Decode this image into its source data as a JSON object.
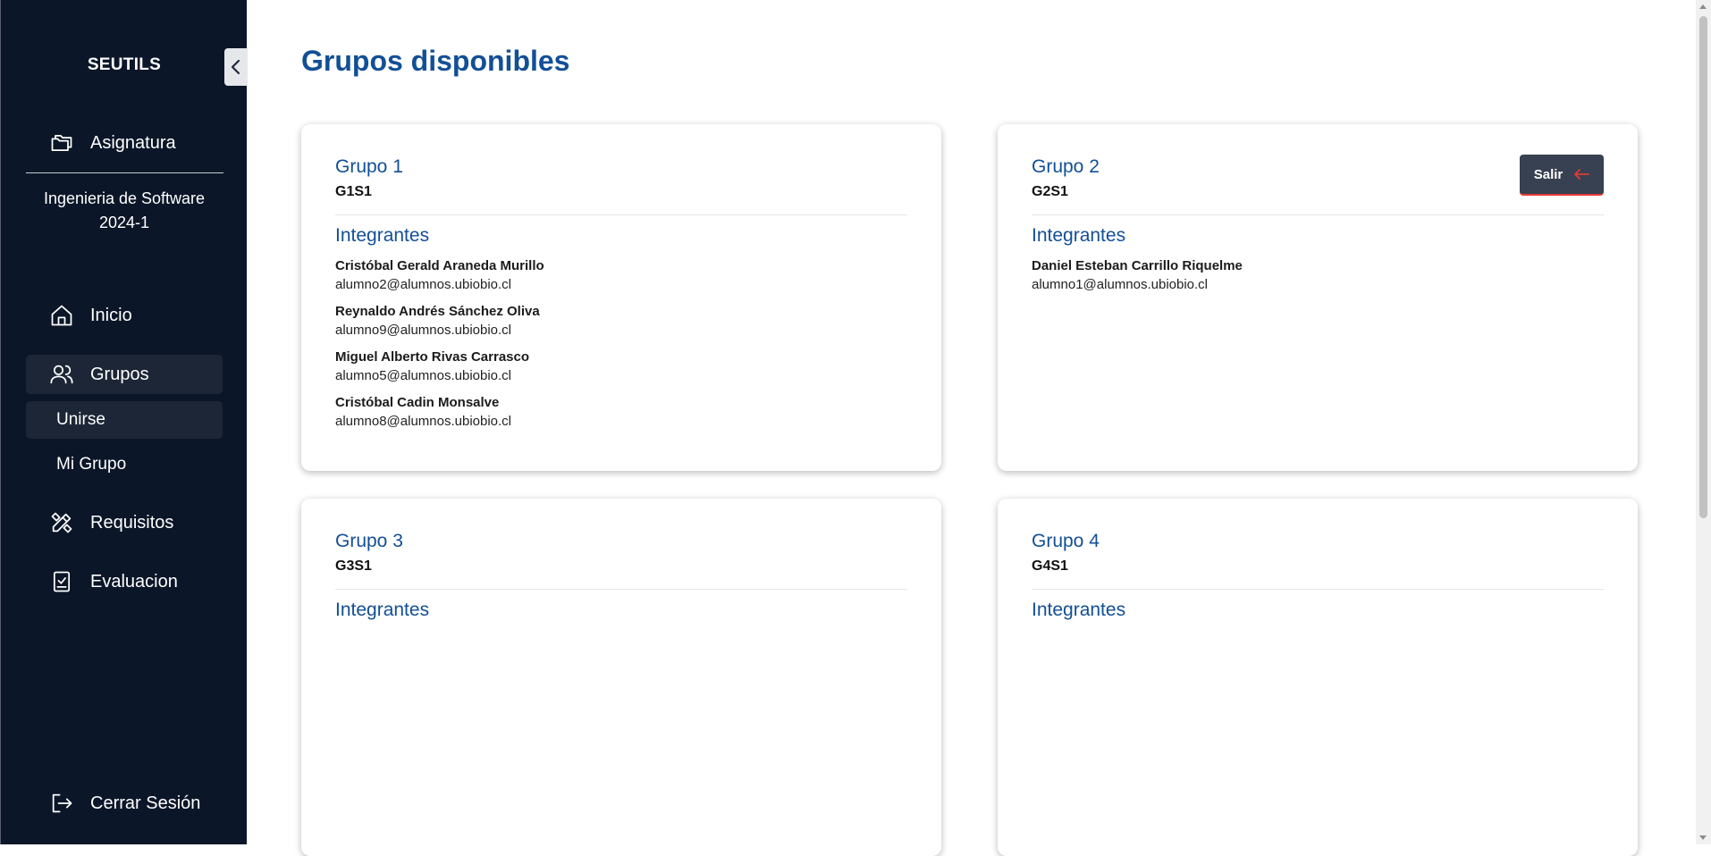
{
  "sidebar": {
    "brand": "SEUTILS",
    "subject_label": "Asignatura",
    "course": {
      "name": "Ingenieria de Software",
      "term": "2024-1"
    },
    "nav": {
      "inicio": "Inicio",
      "grupos": "Grupos",
      "unirse": "Unirse",
      "mi_grupo": "Mi Grupo",
      "requisitos": "Requisitos",
      "evaluacion": "Evaluacion"
    },
    "logout": "Cerrar Sesión"
  },
  "main": {
    "title": "Grupos disponibles",
    "members_heading": "Integrantes",
    "exit_label": "Salir",
    "groups": [
      {
        "name": "Grupo 1",
        "code": "G1S1",
        "members": [
          {
            "name": "Cristóbal Gerald Araneda Murillo",
            "email": "alumno2@alumnos.ubiobio.cl"
          },
          {
            "name": "Reynaldo Andrés Sánchez Oliva",
            "email": "alumno9@alumnos.ubiobio.cl"
          },
          {
            "name": "Miguel Alberto Rivas Carrasco",
            "email": "alumno5@alumnos.ubiobio.cl"
          },
          {
            "name": "Cristóbal Cadin Monsalve",
            "email": "alumno8@alumnos.ubiobio.cl"
          }
        ]
      },
      {
        "name": "Grupo 2",
        "code": "G2S1",
        "members": [
          {
            "name": "Daniel Esteban Carrillo Riquelme",
            "email": "alumno1@alumnos.ubiobio.cl"
          }
        ]
      },
      {
        "name": "Grupo 3",
        "code": "G3S1",
        "members": []
      },
      {
        "name": "Grupo 4",
        "code": "G4S1",
        "members": []
      }
    ]
  },
  "colors": {
    "sidebar_bg": "#0b1628",
    "accent": "#124f96",
    "active_item": "#1c2636",
    "exit_button": "#374151",
    "exit_accent": "#e53935"
  },
  "icons": {
    "asignatura": "folders-icon",
    "inicio": "home-icon",
    "grupos": "users-icon",
    "requisitos": "pencil-ruler-icon",
    "evaluacion": "clipboard-check-icon",
    "logout": "logout-icon",
    "exit": "arrow-left-icon",
    "collapse": "chevron-left-icon"
  }
}
